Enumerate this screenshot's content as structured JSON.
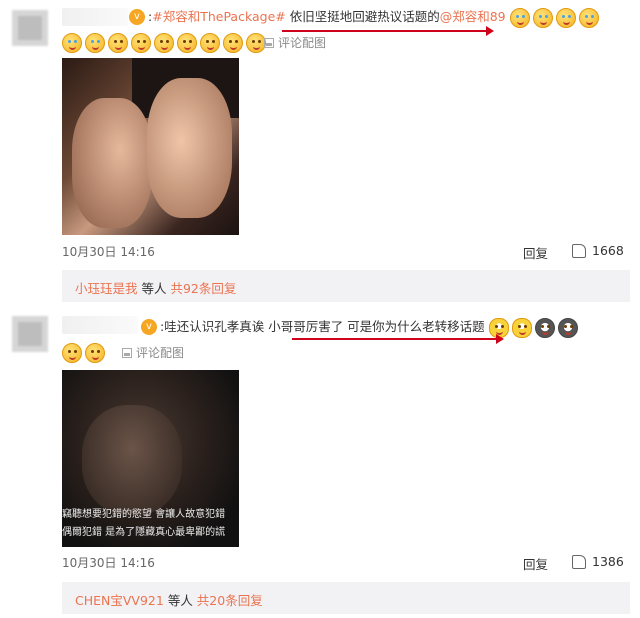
{
  "comments": [
    {
      "text_link_topic": "#郑容和ThePackage#",
      "text_main": "依旧坚挺地回避热议话题的",
      "text_mention": "@郑容和89",
      "pic_tag": "评论配图",
      "time": "10月30日 14:16",
      "reply_label": "回复",
      "like_count": "1668",
      "replies": {
        "who": "小珏珏是我",
        "mid": " 等人 ",
        "more": "共92条回复"
      }
    },
    {
      "text_main": "哇还认识孔孝真诶  小哥哥厉害了  可是你为什么老转移话题",
      "pic_tag": "评论配图",
      "subtitle_1": "竊聽想要犯錯的慾望  會讓人故意犯錯",
      "subtitle_2": "偶爾犯錯  是為了隱藏真心最卑鄙的謊",
      "time": "10月30日 14:16",
      "reply_label": "回复",
      "like_count": "1386",
      "replies": {
        "who": "CHEN宝VV921",
        "mid": " 等人 ",
        "more": "共20条回复"
      }
    }
  ],
  "colors": {
    "accent": "#eb7350",
    "annotation": "#d0021b",
    "reply_bg": "#f2f2f5"
  },
  "icons": [
    "smiley-emoji-icon",
    "crying-laugh-emoji-icon",
    "minion-emoji-icon",
    "husky-emoji-icon",
    "image-icon",
    "thumbs-up-icon"
  ]
}
